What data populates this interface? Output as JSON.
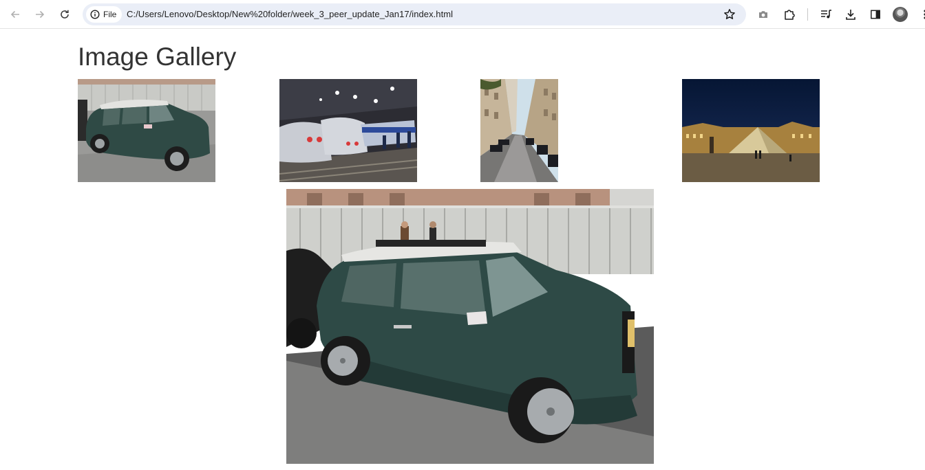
{
  "browser": {
    "protocol_chip": "File",
    "address": "C:/Users/Lenovo/Desktop/New%20folder/week_3_peer_update_Jan17/index.html"
  },
  "page": {
    "title": "Image Gallery"
  },
  "gallery": {
    "thumbnails": [
      {
        "subject": "green-mini-car"
      },
      {
        "subject": "tgv-trains-station"
      },
      {
        "subject": "paris-street"
      },
      {
        "subject": "louvre-pyramid-night"
      }
    ],
    "featured": {
      "subject": "green-mini-car"
    }
  },
  "colors": {
    "title_text": "#333333",
    "omnibox_bg": "#eaeef7",
    "icon_gray": "#5f6368"
  }
}
